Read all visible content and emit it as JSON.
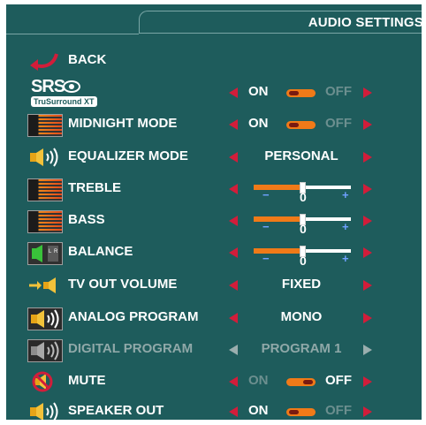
{
  "header": {
    "title": "AUDIO SETTINGS"
  },
  "back": {
    "label": "BACK",
    "icon": "back-arrow-icon"
  },
  "srs": {
    "logo_text": "SRS",
    "badge_text": "TruSurround XT",
    "on": "ON",
    "off": "OFF",
    "state": "on"
  },
  "rows": [
    {
      "id": "midnight",
      "label": "MIDNIGHT MODE",
      "icon": "equalizer-bars-icon",
      "on": "ON",
      "off": "OFF",
      "state": "on"
    },
    {
      "id": "equalizer",
      "label": "EQUALIZER MODE",
      "icon": "speaker-icon",
      "value": "PERSONAL"
    },
    {
      "id": "treble",
      "label": "TREBLE",
      "icon": "equalizer-bars-icon",
      "slider": {
        "value": "0",
        "min": "−",
        "max": "+",
        "level": 0.5
      }
    },
    {
      "id": "bass",
      "label": "BASS",
      "icon": "equalizer-bars-icon",
      "slider": {
        "value": "0",
        "min": "−",
        "max": "+",
        "level": 0.5
      }
    },
    {
      "id": "balance",
      "label": "BALANCE",
      "icon": "balance-speakers-icon",
      "slider": {
        "value": "0",
        "min": "−",
        "max": "+",
        "level": 0.5
      }
    },
    {
      "id": "tvout",
      "label": "TV OUT VOLUME",
      "icon": "tv-out-speaker-icon",
      "value": "FIXED"
    },
    {
      "id": "analog",
      "label": "ANALOG PROGRAM",
      "icon": "speaker-icon",
      "value": "MONO"
    },
    {
      "id": "digital",
      "label": "DIGITAL PROGRAM",
      "icon": "speaker-icon",
      "value": "PROGRAM 1",
      "disabled": true
    },
    {
      "id": "mute",
      "label": "MUTE",
      "icon": "mute-speaker-icon",
      "on": "ON",
      "off": "OFF",
      "state": "off"
    },
    {
      "id": "speakerout",
      "label": "SPEAKER OUT",
      "icon": "speaker-icon",
      "on": "ON",
      "off": "OFF",
      "state": "on"
    }
  ],
  "colors": {
    "background": "#1e5c5c",
    "arrow": "#d21d3a",
    "toggle": "#f07a18",
    "disabled": "#8fa8a8"
  }
}
